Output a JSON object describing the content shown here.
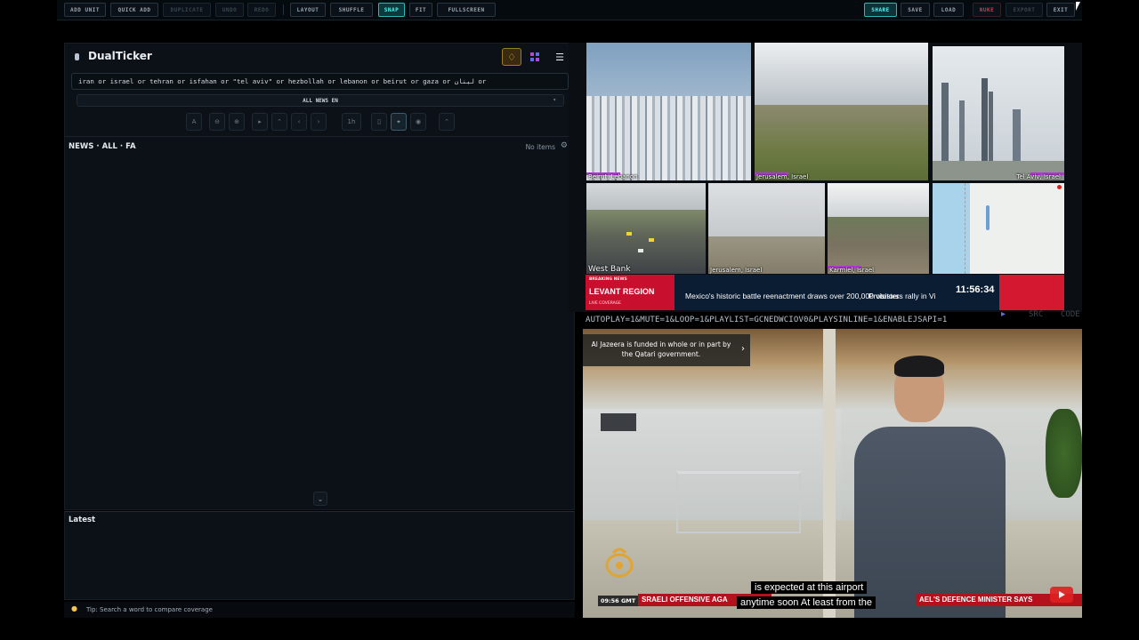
{
  "toolbar": {
    "add_unit": "ADD UNIT",
    "quick_add": "QUICK ADD",
    "duplicate": "DUPLICATE",
    "undo": "UNDO",
    "redo": "REDO",
    "layout": "LAYOUT",
    "shuffle": "SHUFFLE",
    "snap": "SNAP",
    "fit": "FIT",
    "fullscreen": "FULLSCREEN",
    "share": "SHARE",
    "save": "SAVE",
    "load": "LOAD",
    "nuke": "NUKE",
    "export": "EXPORT",
    "exit": "EXIT"
  },
  "app": {
    "title": "DualTicker",
    "query": "iran or israel or tehran or isfahan or \"tel aviv\" or hezbollah or lebanon or beirut or gaza or لبنان or",
    "source_select": "ALL NEWS EN",
    "controls": {
      "font": "A",
      "timeframe": "1h"
    },
    "news_header": "NEWS · ALL · FA",
    "news_count": "No items",
    "latest_header": "Latest",
    "tip": "Tip: Search a word to compare coverage"
  },
  "cameras": [
    {
      "label": "Beirut, Lebanon"
    },
    {
      "label": "Jerusalem, Israel"
    },
    {
      "label": "Tel Aviv, Israel"
    },
    {
      "label": "West Bank"
    },
    {
      "label": "Jerusalem, Israel"
    },
    {
      "label": "Karmiel, Israel"
    },
    {
      "label": ""
    }
  ],
  "ticker": {
    "breaking": "BREAKING NEWS",
    "region": "LEVANT REGION",
    "live": "LIVE COVERAGE",
    "headline": "Mexico's historic battle reenactment draws over 200,000 visitors",
    "headline2": "Protesters rally in Vi",
    "time": "11:56:34"
  },
  "stream": {
    "url": "AUTOPLAY=1&MUTE=1&LOOP=1&PLAYLIST=GCNEDWCIOV0&PLAYSINLINE=1&ENABLEJSAPI=1",
    "src_label": "SRC",
    "code_label": "CODE"
  },
  "video": {
    "funding_notice": "Al Jazeera is funded in whole or in part by the Qatari government.",
    "timestamp": "09:56 GMT",
    "ticker_left": "SRAELI OFFENSIVE AGA",
    "ticker_right": "AEL'S DEFENCE MINISTER SAYS",
    "caption_line1": "is expected at this airport",
    "caption_line2": "anytime soon At least from the"
  },
  "colors": {
    "accent": "#5ff0f0",
    "danger": "#e3344a",
    "panel": "#0c1117",
    "cam_marker": "#b43ad6",
    "aj_red": "#b3121d"
  },
  "icons": {
    "palette": "palette-icon",
    "grid": "grid-icon",
    "menu": "hamburger-icon",
    "settings": "gear-icon",
    "tip": "lightbulb-icon"
  }
}
